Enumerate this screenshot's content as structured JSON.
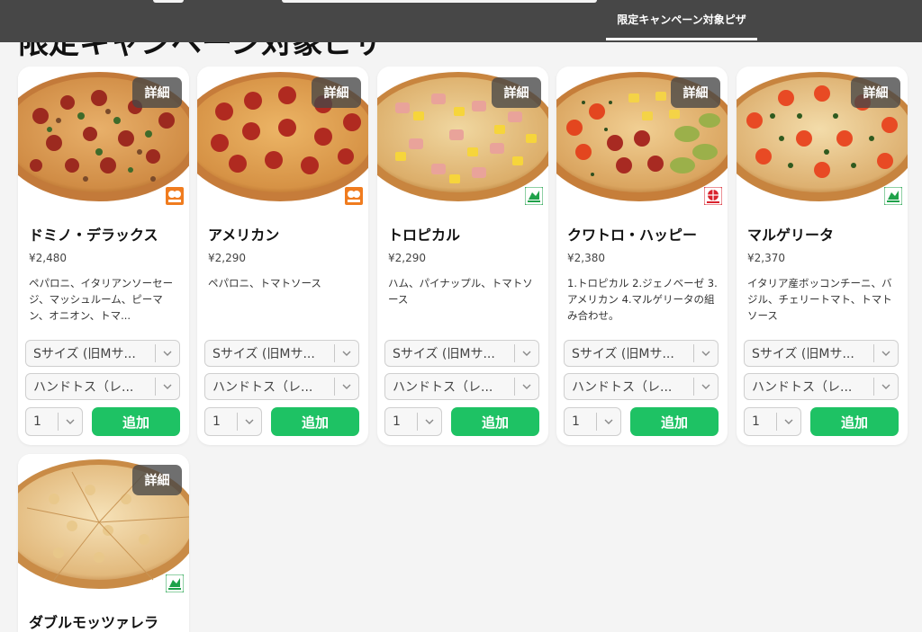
{
  "nav": {
    "active_tab": "限定キャンペーン対象ピザ"
  },
  "heading": "限定キャンペーン対象ピザ",
  "labels": {
    "detail": "詳細",
    "add": "追加"
  },
  "colors": {
    "accent_green": "#1ec264",
    "nav_bg": "#474747",
    "badge_orange": "#f07c1f",
    "badge_green": "#1fa24a",
    "badge_red": "#d9232e"
  },
  "products": [
    {
      "name": "ドミノ・デラックス",
      "price": "¥2,480",
      "description": "ペパロニ、イタリアンソーセージ、マッシュルーム、ピーマン、オニオン、トマ...",
      "size": "Sサイズ (旧Mサ...",
      "crust": "ハンドトス（レ...",
      "quantity": "1",
      "badge_icon": "orange-chicken-badge-icon"
    },
    {
      "name": "アメリカン",
      "price": "¥2,290",
      "description": "ペパロニ、トマトソース",
      "size": "Sサイズ (旧Mサ...",
      "crust": "ハンドトス（レ...",
      "quantity": "1",
      "badge_icon": "orange-chicken-badge-icon"
    },
    {
      "name": "トロピカル",
      "price": "¥2,290",
      "description": "ハム、パイナップル、トマトソース",
      "size": "Sサイズ (旧Mサ...",
      "crust": "ハンドトス（レ...",
      "quantity": "1",
      "badge_icon": "green-leaf-badge-icon"
    },
    {
      "name": "クワトロ・ハッピー",
      "price": "¥2,380",
      "description": "1.トロピカル 2.ジェノベーゼ 3.アメリカン 4.マルゲリータの組み合わせ。",
      "size": "Sサイズ (旧Mサ...",
      "crust": "ハンドトス（レ...",
      "quantity": "1",
      "badge_icon": "red-quattro-badge-icon"
    },
    {
      "name": "マルゲリータ",
      "price": "¥2,370",
      "description": "イタリア産ボッコンチーニ、バジル、チェリートマト、トマトソース",
      "size": "Sサイズ (旧Mサ...",
      "crust": "ハンドトス（レ...",
      "quantity": "1",
      "badge_icon": "green-leaf-badge-icon"
    },
    {
      "name": "ダブルモッツァレラ",
      "price": "",
      "description": "",
      "size": "",
      "crust": "",
      "quantity": "",
      "badge_icon": "green-leaf-badge-icon"
    }
  ]
}
